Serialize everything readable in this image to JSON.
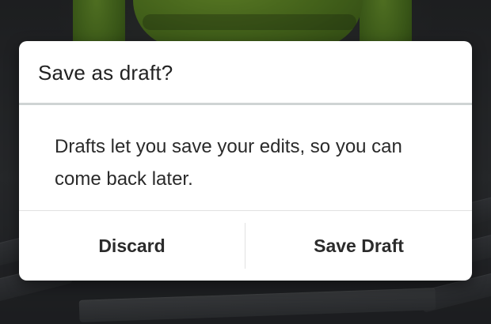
{
  "dialog": {
    "title": "Save as draft?",
    "message": "Drafts let you save your edits, so you can come back later.",
    "buttons": {
      "discard": "Discard",
      "save_draft": "Save Draft"
    }
  },
  "colors": {
    "dialog_background": "#ffffff",
    "title_divider": "#cfd4d4",
    "text": "#222222",
    "background_accent": "#6a9a2a"
  }
}
